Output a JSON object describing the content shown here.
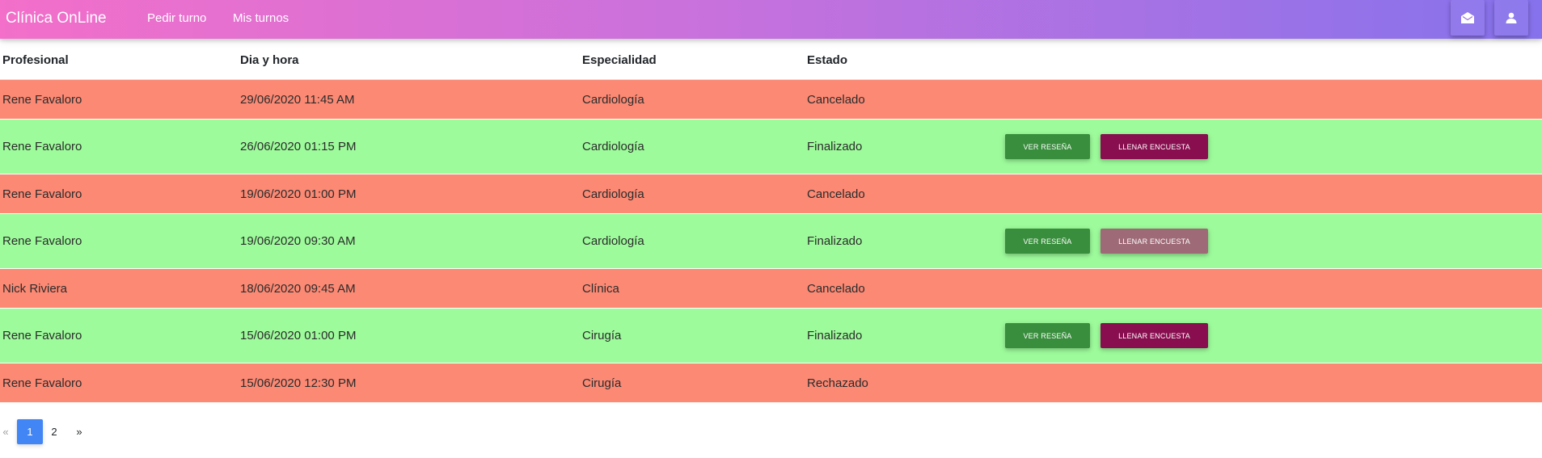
{
  "navbar": {
    "brand": "Clínica OnLine",
    "links": [
      "Pedir turno",
      "Mis turnos"
    ],
    "icons": [
      "mail-open-icon",
      "user-icon"
    ]
  },
  "table": {
    "headers": [
      "Profesional",
      "Dia y hora",
      "Especialidad",
      "Estado"
    ],
    "rows": [
      {
        "profesional": "Rene Favaloro",
        "fecha": "29/06/2020 11:45 AM",
        "especialidad": "Cardiología",
        "estado": "Cancelado"
      },
      {
        "profesional": "Rene Favaloro",
        "fecha": "26/06/2020 01:15 PM",
        "especialidad": "Cardiología",
        "estado": "Finalizado",
        "resena_label": "VER RESEÑA",
        "encuesta_label": "LLENAR ENCUESTA"
      },
      {
        "profesional": "Rene Favaloro",
        "fecha": "19/06/2020 01:00 PM",
        "especialidad": "Cardiología",
        "estado": "Cancelado"
      },
      {
        "profesional": "Rene Favaloro",
        "fecha": "19/06/2020 09:30 AM",
        "especialidad": "Cardiología",
        "estado": "Finalizado",
        "resena_label": "VER RESEÑA",
        "encuesta_label": "LLENAR ENCUESTA"
      },
      {
        "profesional": "Nick Riviera",
        "fecha": "18/06/2020 09:45 AM",
        "especialidad": "Clínica",
        "estado": "Cancelado"
      },
      {
        "profesional": "Rene Favaloro",
        "fecha": "15/06/2020 01:00 PM",
        "especialidad": "Cirugía",
        "estado": "Finalizado",
        "resena_label": "VER RESEÑA",
        "encuesta_label": "LLENAR ENCUESTA"
      },
      {
        "profesional": "Rene Favaloro",
        "fecha": "15/06/2020 12:30 PM",
        "especialidad": "Cirugía",
        "estado": "Rechazado"
      }
    ]
  },
  "pagination": {
    "prev": "«",
    "pages": [
      "1",
      "2"
    ],
    "current": "1",
    "next": "»"
  },
  "colors": {
    "cancelled_row": "#fb8974",
    "finished_row": "#9dfb9b",
    "resena_button": "#388e3c",
    "encuesta_button": "#880e4f",
    "encuesta_button_disabled": "#9e6a77",
    "active_page": "#4285f4"
  }
}
